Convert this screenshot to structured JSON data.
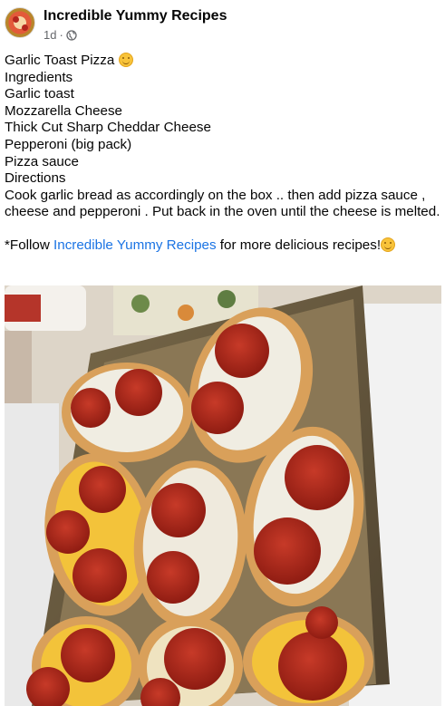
{
  "header": {
    "page_name": "Incredible Yummy Recipes",
    "timestamp": "1d",
    "separator": "·",
    "privacy_icon": "globe-icon",
    "avatar_icon": "pizza-avatar"
  },
  "post": {
    "title": "Garlic Toast Pizza",
    "title_emoji": "smiling-face-emoji",
    "lines": [
      "Ingredients",
      "Garlic toast",
      "Mozzarella Cheese",
      "Thick Cut Sharp Cheddar Cheese",
      "Pepperoni (big pack)",
      "Pizza sauce",
      "Directions"
    ],
    "directions": "Cook garlic bread as accordingly on the box .. then add pizza sauce , cheese and pepperoni . Put back in the oven until the cheese is melted.",
    "follow_prefix": "*Follow ",
    "follow_link": "Incredible Yummy Recipes",
    "follow_suffix": " for more delicious recipes!",
    "follow_emoji": "smiling-face-emoji"
  },
  "photo": {
    "subject": "garlic-toast-pizzas-on-baking-sheet"
  },
  "colors": {
    "link": "#1b74e4",
    "meta": "#65676b",
    "text": "#050505"
  }
}
